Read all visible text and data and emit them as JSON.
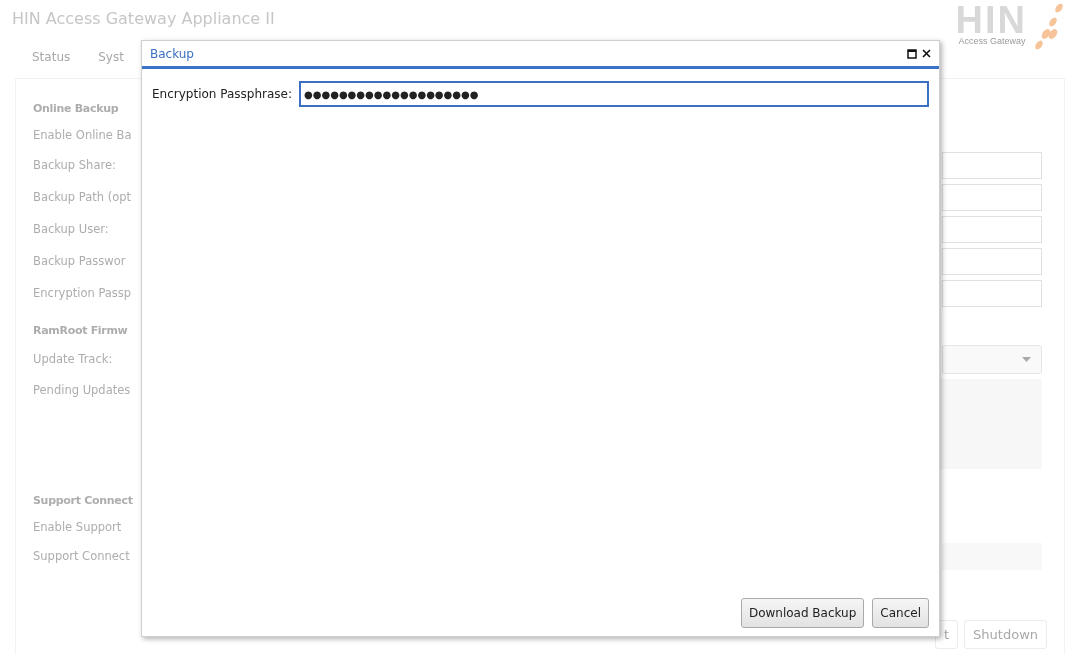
{
  "app": {
    "title": "HIN Access Gateway Appliance II",
    "logo": {
      "wordmark": "HIN",
      "subtitle": "Access Gateway"
    }
  },
  "tabs": [
    {
      "label": "Status"
    },
    {
      "label": "Syst"
    }
  ],
  "background_form": {
    "rows": [
      {
        "kind": "heading",
        "label": "Online Backup"
      },
      {
        "kind": "label",
        "label": "Enable Online Ba"
      },
      {
        "kind": "field",
        "label": "Backup Share:"
      },
      {
        "kind": "field",
        "label": "Backup Path (opt"
      },
      {
        "kind": "field",
        "label": "Backup User:"
      },
      {
        "kind": "field",
        "label": "Backup Passwor"
      },
      {
        "kind": "field",
        "label": "Encryption Passp"
      },
      {
        "kind": "heading",
        "label": "RamRoot Firmw"
      },
      {
        "kind": "select",
        "label": "Update Track:"
      },
      {
        "kind": "textarea",
        "label": "Pending Updates"
      },
      {
        "kind": "heading",
        "label": "Support Connect"
      },
      {
        "kind": "label",
        "label": "Enable Support"
      },
      {
        "kind": "readonly",
        "label": "Support Connect"
      }
    ]
  },
  "background_buttons": [
    "t",
    "Shutdown"
  ],
  "dialog": {
    "title": "Backup",
    "field": {
      "label": "Encryption Passphrase:",
      "value": "●●●●●●●●●●●●●●●●●●●●"
    },
    "buttons": [
      "Download Backup",
      "Cancel"
    ]
  }
}
